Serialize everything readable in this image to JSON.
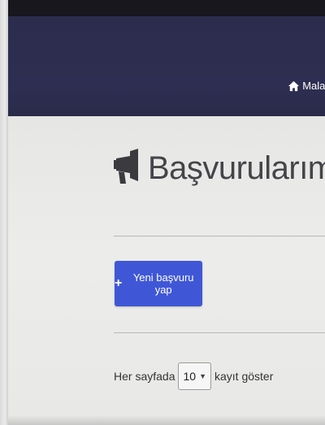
{
  "navbar": {
    "home_link_label": "Malat",
    "home_icon": "home-icon"
  },
  "page": {
    "title": "Başvurularım",
    "title_icon": "megaphone-icon"
  },
  "actions": {
    "new_application_label": "Yeni başvuru yap",
    "new_application_icon": "plus-icon"
  },
  "table_length": {
    "prefix": "Her sayfada",
    "selected_value": "10",
    "suffix": "kayıt göster"
  },
  "colors": {
    "navbar_bg": "#2e2e52",
    "primary": "#3f57d6",
    "content_bg": "#ececea"
  }
}
